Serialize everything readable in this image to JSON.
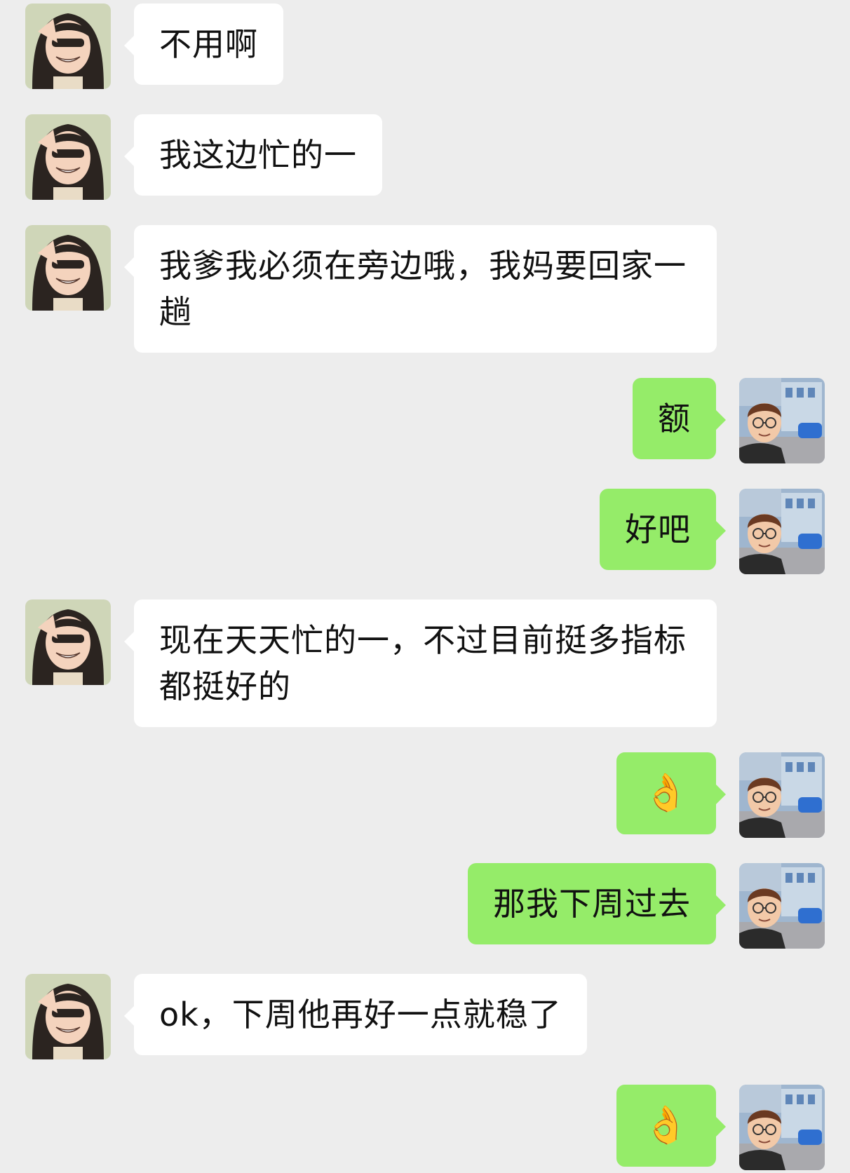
{
  "chat": {
    "messages": [
      {
        "sender": "other",
        "text": "不用啊"
      },
      {
        "sender": "other",
        "text": "我这边忙的一"
      },
      {
        "sender": "other",
        "text": "我爹我必须在旁边哦，我妈要回家一趟"
      },
      {
        "sender": "me",
        "text": "额"
      },
      {
        "sender": "me",
        "text": "好吧"
      },
      {
        "sender": "other",
        "text": "现在天天忙的一，不过目前挺多指标都挺好的"
      },
      {
        "sender": "me",
        "text": "👌",
        "icon": "ok-hand-icon"
      },
      {
        "sender": "me",
        "text": "那我下周过去"
      },
      {
        "sender": "other",
        "text": "ok，下周他再好一点就稳了"
      },
      {
        "sender": "me",
        "text": "👌",
        "icon": "ok-hand-icon"
      }
    ]
  },
  "colors": {
    "background": "#ededed",
    "incoming_bubble": "#ffffff",
    "outgoing_bubble": "#95ec69",
    "text": "#111111"
  }
}
